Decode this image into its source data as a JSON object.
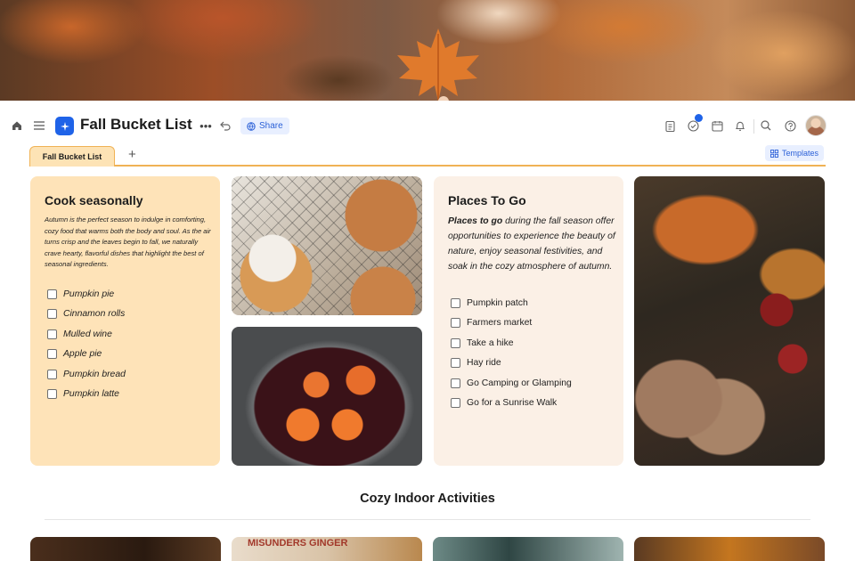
{
  "header": {
    "title": "Fall Bucket List",
    "share_label": "Share"
  },
  "tabs": {
    "active_label": "Fall Bucket List",
    "add_label": "+",
    "templates_label": "Templates"
  },
  "cook_card": {
    "title": "Cook seasonally",
    "description": "Autumn is the perfect season to indulge in comforting, cozy food that warms both the body and soul. As the air turns crisp and the leaves begin to fall, we naturally crave hearty, flavorful dishes that highlight the best of seasonal ingredients.",
    "items": [
      "Pumpkin pie",
      "Cinnamon rolls",
      "Mulled wine",
      "Apple pie",
      "Pumpkin bread",
      "Pumpkin latte"
    ]
  },
  "places_card": {
    "title": "Places To Go",
    "description_bold": "Places to go",
    "description_rest": " during the fall season offer opportunities to experience the beauty of nature, enjoy seasonal festivities, and soak in the cozy atmosphere of autumn.",
    "items": [
      "Pumpkin patch",
      "Farmers market",
      "Take a hike",
      "Hay ride",
      "Go Camping or Glamping",
      "Go for a Sunrise Walk"
    ]
  },
  "section": {
    "title": "Cozy Indoor Activities",
    "thumb_text": "MISUNDERS GINGER"
  },
  "colors": {
    "accent": "#1f63e8",
    "tab_border": "#f0b255",
    "cook_bg": "#fee3b8",
    "places_bg": "#fbf0e6"
  }
}
